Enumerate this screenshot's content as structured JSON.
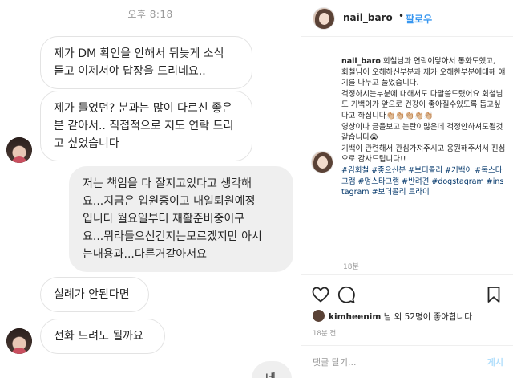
{
  "dm": {
    "timestamp": "오후 8:18",
    "messages": [
      {
        "side": "in",
        "text": "제가 DM 확인을 안해서 뒤늦게 소식\n듣고 이제서야 답장을 드리네요.."
      },
      {
        "side": "in",
        "text": "제가 들었던? 분과는 많이 다르신 좋은\n분 같아서.. 직접적으로 저도 연락 드리\n고 싶었습니다"
      },
      {
        "side": "out",
        "text": "저는 책임을 다 잘지고있다고 생각해\n요...지금은 입원중이고 내일퇴원예정\n입니다 월요일부터 재활준비중이구\n요...뭐라들으신건지는모르겠지만 아시\n는내용과...다른거같아서요"
      },
      {
        "side": "in",
        "text": "실례가 안된다면"
      },
      {
        "side": "in",
        "text": "전화 드려도 될까요"
      },
      {
        "side": "out",
        "text": "네"
      }
    ]
  },
  "post": {
    "username": "nail_baro",
    "dot": "•",
    "follow_label": "팔로우",
    "caption_username": "nail_baro",
    "caption_paragraphs": [
      "회철님과 연락이닿아서 통화도했고,",
      "회철님이 오해하신부분과 제가 오해한부분에대해 얘기를 나누고 풀었습니다.",
      "걱정하시는부분에 대해서도 다말씀드렸어요 회철님도 기백이가 앞으로 건강이 좋아질수있도록 돕고싶다고 하십니다👏🏼👏🏼👏🏼👏🏼👏🏼",
      "영상이나 글을보고 논란이많은데 걱정안하셔도될것같습니다😭",
      "기백이 관련해서 관심가져주시고 응원해주셔서 진심으로 감사드립니다!!"
    ],
    "hashtags": "#김회철 #좋으신분 #보더콜리 #기백이 #독스타그램 #멍스타그램 #반려견 #dogstagram #instagram #보더콜리 트라이",
    "caption_time": "18분",
    "likes_user": "kimheenim",
    "likes_suffix": "님 외 52명이 좋아합니다",
    "post_age": "18분 전",
    "comment_placeholder": "댓글 달기...",
    "post_button": "게시"
  }
}
